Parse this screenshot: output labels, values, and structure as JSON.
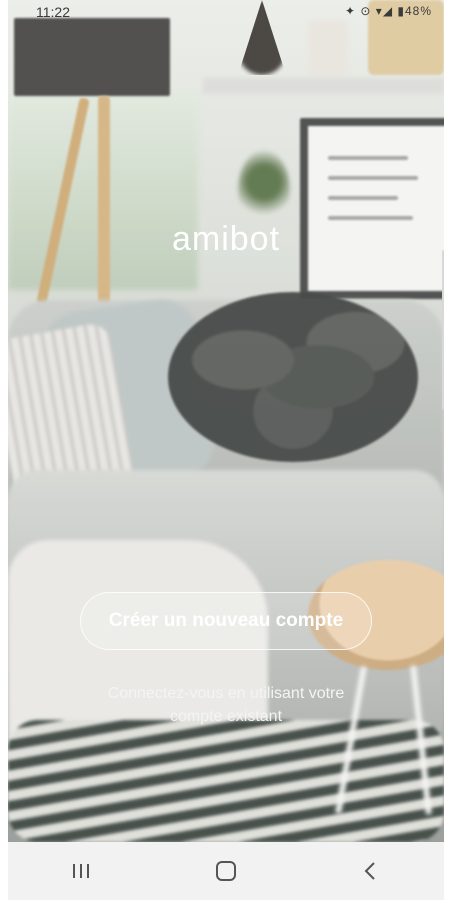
{
  "status_bar": {
    "time": "11:22",
    "indicators": "✦ ⊙ ▾◢ ▮48%"
  },
  "logo": {
    "text": "amibot"
  },
  "actions": {
    "create_account": "Créer un nouveau compte",
    "login_line1": "Connectez-vous en utilisant votre",
    "login_line2": "compte existant"
  },
  "nav_bar": {
    "recent_icon": "recent-apps-icon",
    "home_icon": "home-icon",
    "back_icon": "back-icon"
  }
}
